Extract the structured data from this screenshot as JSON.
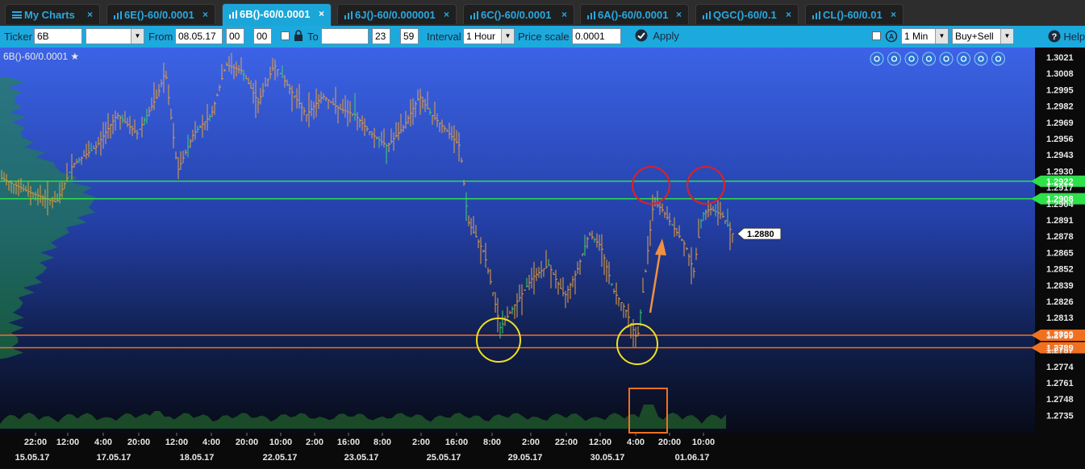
{
  "tabs": [
    {
      "label": "My Charts",
      "active": false,
      "icon": "menu-icon"
    },
    {
      "label": "6E()-60/0.0001",
      "active": false,
      "icon": "chart-icon"
    },
    {
      "label": "6B()-60/0.0001",
      "active": true,
      "icon": "chart-icon"
    },
    {
      "label": "6J()-60/0.000001",
      "active": false,
      "icon": "chart-icon"
    },
    {
      "label": "6C()-60/0.0001",
      "active": false,
      "icon": "chart-icon"
    },
    {
      "label": "6A()-60/0.0001",
      "active": false,
      "icon": "chart-icon"
    },
    {
      "label": "QGC()-60/0.1",
      "active": false,
      "icon": "chart-icon"
    },
    {
      "label": "CL()-60/0.01",
      "active": false,
      "icon": "chart-icon"
    }
  ],
  "tab_close": "×",
  "toolbar": {
    "ticker_label": "Ticker",
    "ticker_value": "6B",
    "from_label": "From",
    "from_date": "08.05.17",
    "from_hour": "00",
    "from_min": "00",
    "to_label": "To",
    "to_date": "",
    "to_hour": "23",
    "to_min": "59",
    "interval_label": "Interval",
    "interval_value": "1 Hour",
    "price_scale_label": "Price scale",
    "price_scale_value": "0.0001",
    "apply_label": "Apply",
    "timeframe_value": "1 Min",
    "mode_value": "Buy+Sell",
    "help_label": "Help"
  },
  "chart_title": "6B()-60/0.0001",
  "price_axis": [
    "1.3021",
    "1.3008",
    "1.2995",
    "1.2982",
    "1.2969",
    "1.2956",
    "1.2943",
    "1.2930",
    "1.2917",
    "1.2904",
    "1.2891",
    "1.2878",
    "1.2865",
    "1.2852",
    "1.2839",
    "1.2826",
    "1.2813",
    "1.2800",
    "1.2787",
    "1.2774",
    "1.2761",
    "1.2748",
    "1.2735"
  ],
  "time_axis": [
    "22:00",
    "12:00",
    "4:00",
    "20:00",
    "12:00",
    "4:00",
    "20:00",
    "10:00",
    "2:00",
    "16:00",
    "8:00",
    "2:00",
    "16:00",
    "8:00",
    "2:00",
    "22:00",
    "12:00",
    "4:00",
    "20:00",
    "10:00"
  ],
  "date_axis": [
    "15.05.17",
    "17.05.17",
    "18.05.17",
    "22.05.17",
    "23.05.17",
    "25.05.17",
    "29.05.17",
    "30.05.17",
    "01.06.17"
  ],
  "levels": {
    "green_upper": "1.2922",
    "green_lower": "1.2908",
    "orange_upper": "1.2799",
    "orange_lower": "1.2789",
    "last_price": "1.2880"
  },
  "colors": {
    "tab_accent": "#29a8e0",
    "toolbar_bg": "#1ca9de",
    "chart_top": "#3a5fe0",
    "chart_bottom": "#0a0d1a",
    "candle": "#e8a040",
    "green_level": "#2ee04a",
    "orange_level": "#f07020",
    "red_circle": "#e02020",
    "yellow_circle": "#f0e020"
  },
  "chart_icons": [
    "zoom-in-icon",
    "zoom-out-icon",
    "zoom-reset-icon",
    "grid-icon",
    "draw-icon",
    "settings-icon",
    "fullscreen-icon",
    "dropdown-icon"
  ]
}
